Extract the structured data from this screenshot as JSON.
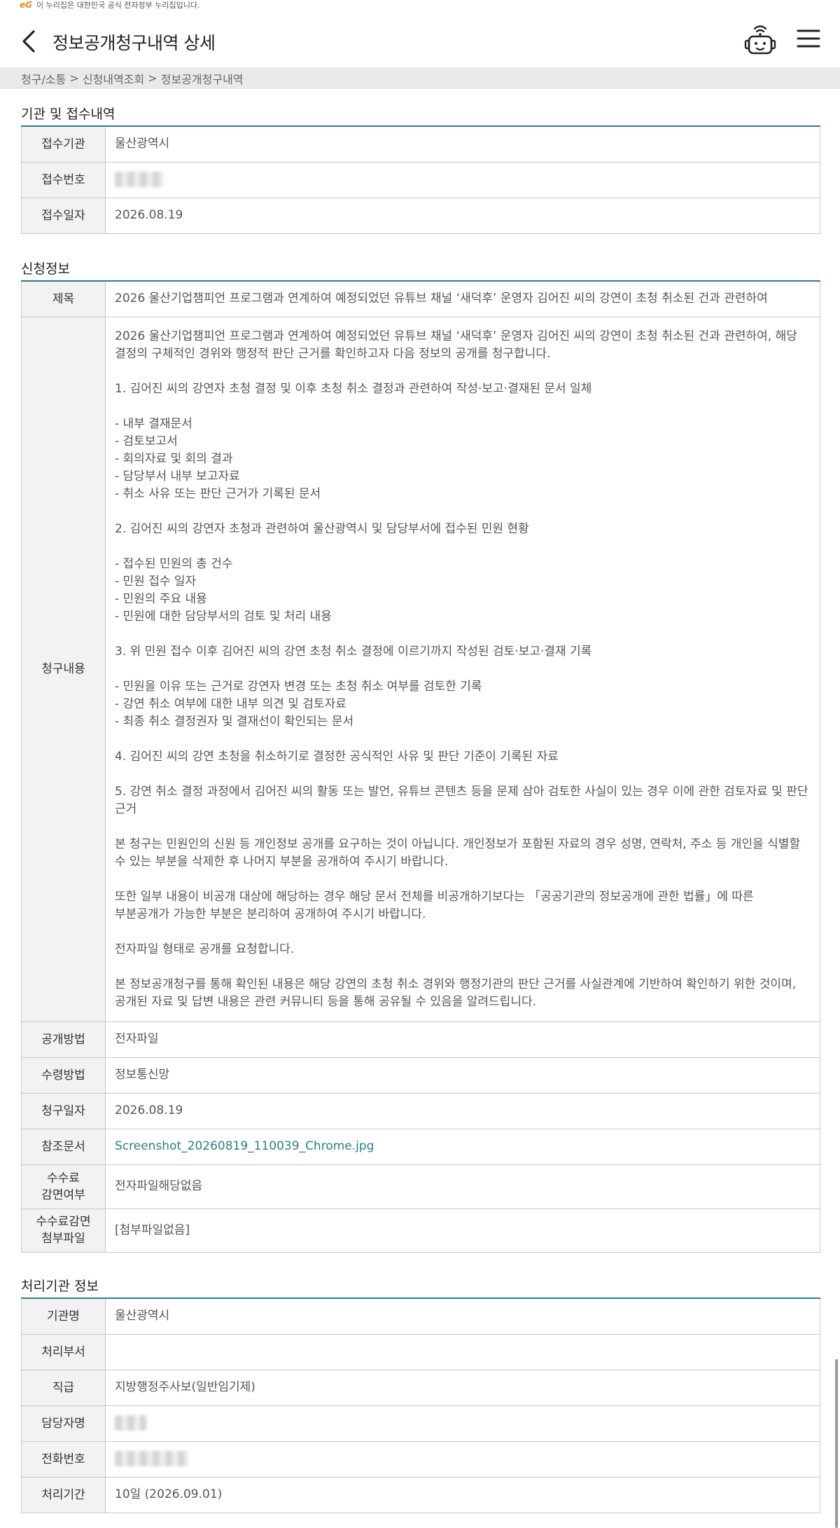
{
  "banner": {
    "logo": "eG",
    "text": "이 누리집은 대한민국 공식 전자정부 누리집입니다."
  },
  "header": {
    "title": "정보공개청구내역 상세",
    "back_icon": "chevron-left-icon",
    "bot_icon": "chatbot-icon",
    "menu_icon": "hamburger-menu-icon"
  },
  "breadcrumb": [
    "청구/소통",
    "신청내역조회",
    "정보공개청구내역"
  ],
  "breadcrumb_separator": " > ",
  "agency_section": {
    "title": "기관 및 접수내역",
    "rows": [
      {
        "label": "접수기관",
        "value": "울산광역시"
      },
      {
        "label": "접수번호",
        "value": ""
      },
      {
        "label": "접수일자",
        "value": "2026.08.19"
      }
    ]
  },
  "request_section": {
    "title": "신청정보",
    "subject_label": "제목",
    "subject": "2026 울산기업챔피언 프로그램과 연계하여 예정되었던 유튜브 채널 ‘새덕후’ 운영자 김어진 씨의 강연이 초청 취소된 건과 관련하여",
    "content_label": "청구내용",
    "content": "2026 울산기업챔피언 프로그램과 연계하여 예정되었던 유튜브 채널 ‘새덕후’ 운영자 김어진 씨의 강연이 초청 취소된 건과 관련하여, 해당 결정의 구체적인 경위와 행정적 판단 근거를 확인하고자 다음 정보의 공개를 청구합니다.\n\n1. 김어진 씨의 강연자 초청 결정 및 이후 초청 취소 결정과 관련하여 작성·보고·결재된 문서 일체\n\n- 내부 결재문서\n- 검토보고서\n- 회의자료 및 회의 결과\n- 담당부서 내부 보고자료\n- 취소 사유 또는 판단 근거가 기록된 문서\n\n2. 김어진 씨의 강연자 초청과 관련하여 울산광역시 및 담당부서에 접수된 민원 현황\n\n- 접수된 민원의 총 건수\n- 민원 접수 일자\n- 민원의 주요 내용\n- 민원에 대한 담당부서의 검토 및 처리 내용\n\n3. 위 민원 접수 이후 김어진 씨의 강연 초청 취소 결정에 이르기까지 작성된 검토·보고·결재 기록\n\n- 민원을 이유 또는 근거로 강연자 변경 또는 초청 취소 여부를 검토한 기록\n- 강연 취소 여부에 대한 내부 의견 및 검토자료\n- 최종 취소 결정권자 및 결재선이 확인되는 문서\n\n4. 김어진 씨의 강연 초청을 취소하기로 결정한 공식적인 사유 및 판단 기준이 기록된 자료\n\n5. 강연 취소 결정 과정에서 김어진 씨의 활동 또는 발언, 유튜브 콘텐츠 등을 문제 삼아 검토한 사실이 있는 경우 이에 관한 검토자료 및 판단 근거\n\n본 청구는 민원인의 신원 등 개인정보 공개를 요구하는 것이 아닙니다. 개인정보가 포함된 자료의 경우 성명, 연락처, 주소 등 개인을 식별할 수 있는 부분을 삭제한 후 나머지 부분을 공개하여 주시기 바랍니다.\n\n또한 일부 내용이 비공개 대상에 해당하는 경우 해당 문서 전체를 비공개하기보다는 「공공기관의 정보공개에 관한 법률」에 따른 부분공개가 가능한 부분은 분리하여 공개하여 주시기 바랍니다.\n\n전자파일 형태로 공개를 요청합니다.\n\n본 정보공개청구를 통해 확인된 내용은 해당 강연의 초청 취소 경위와 행정기관의 판단 근거를 사실관계에 기반하여 확인하기 위한 것이며, 공개된 자료 및 답변 내용은 관련 커뮤니티 등을 통해 공유될 수 있음을 알려드립니다.",
    "rows": [
      {
        "label": "공개방법",
        "value": "전자파일"
      },
      {
        "label": "수령방법",
        "value": "정보통신망"
      },
      {
        "label": "청구일자",
        "value": "2026.08.19"
      },
      {
        "label": "참조문서",
        "value": "Screenshot_20260819_110039_Chrome.jpg"
      },
      {
        "label": "수수료\n감면여부",
        "value": "전자파일해당없음"
      },
      {
        "label": "수수료감면\n첨부파일",
        "value": "[첨부파일없음]"
      }
    ]
  },
  "processing_section": {
    "title": "처리기관 정보",
    "rows": [
      {
        "label": "기관명",
        "value": "울산광역시"
      },
      {
        "label": "처리부서",
        "value": ""
      },
      {
        "label": "직급",
        "value": "지방행정주사보(일반임기제)"
      },
      {
        "label": "담당자명",
        "value": ""
      },
      {
        "label": "전화번호",
        "value": ""
      },
      {
        "label": "처리기간",
        "value": "10일 (2026.09.01)"
      }
    ]
  },
  "colors": {
    "accent": "#2a7f8a",
    "header_bg": "#f2f2f2",
    "border": "#c8c8c8",
    "breadcrumb_bg": "#e9e9e9"
  }
}
